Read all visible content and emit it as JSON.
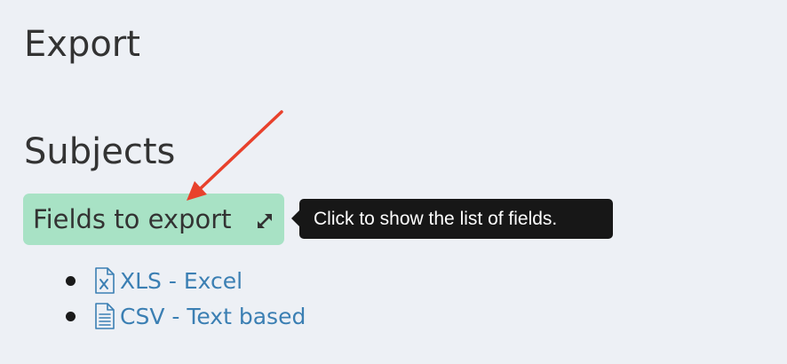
{
  "page": {
    "title": "Export"
  },
  "section": {
    "title": "Subjects"
  },
  "fields_toggle": {
    "label": "Fields to export",
    "icon": "expand-icon"
  },
  "tooltip": {
    "text": "Click to show the list of fields."
  },
  "annotation": {
    "arrow_color": "#e8412c"
  },
  "exports": [
    {
      "label": "XLS - Excel",
      "icon": "excel-file-icon"
    },
    {
      "label": "CSV - Text based",
      "icon": "text-file-icon"
    }
  ],
  "colors": {
    "background": "#edf0f5",
    "toggle_background": "#a8e2c5",
    "link": "#3b7fb3",
    "tooltip_background": "#171717"
  }
}
